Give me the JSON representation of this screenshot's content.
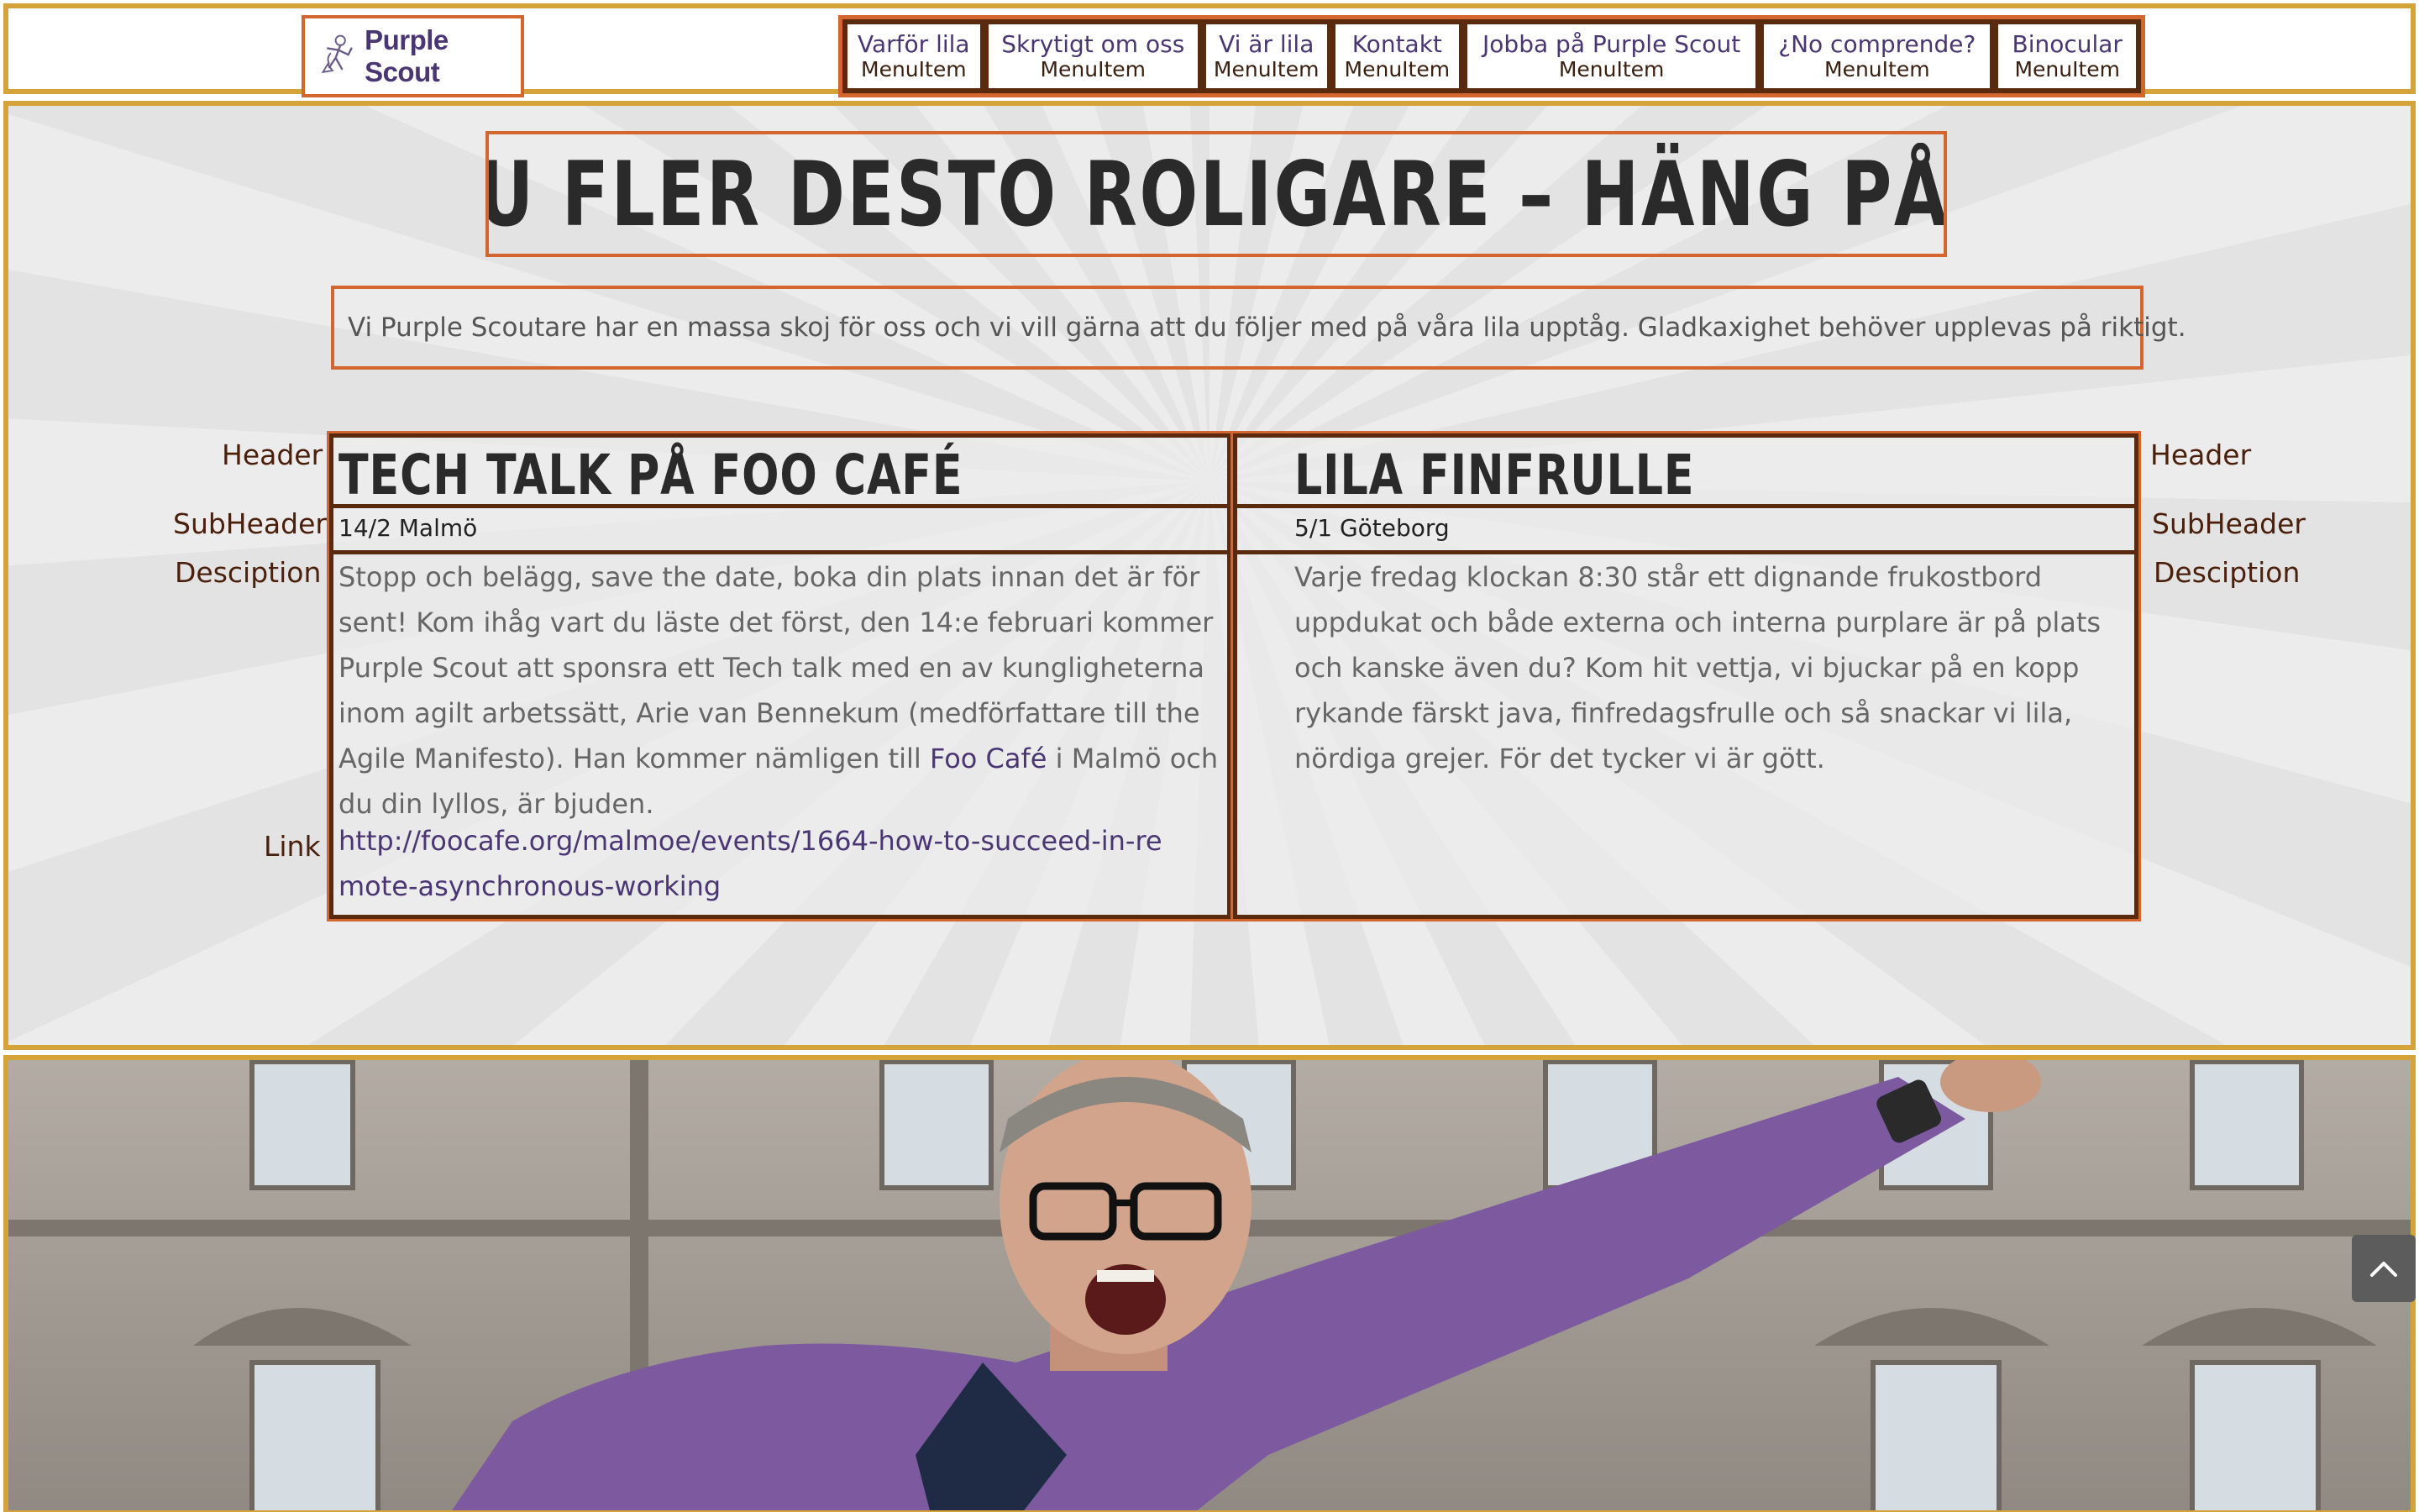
{
  "logo": {
    "text": "Purple Scout"
  },
  "menu": {
    "items": [
      {
        "label": "Varför lila",
        "sub": "MenuItem"
      },
      {
        "label": "Skrytigt om oss",
        "sub": "MenuItem"
      },
      {
        "label": "Vi är lila",
        "sub": "MenuItem"
      },
      {
        "label": "Kontakt",
        "sub": "MenuItem"
      },
      {
        "label": "Jobba på Purple Scout",
        "sub": "MenuItem"
      },
      {
        "label": "¿No comprende?",
        "sub": "MenuItem"
      },
      {
        "label": "Binocular",
        "sub": "MenuItem"
      }
    ]
  },
  "hero": {
    "headline": "JU FLER DESTO ROLIGARE –   HÄNG PÅ!",
    "intro": "Vi Purple Scoutare har en massa skoj för oss och vi vill gärna att du följer med på våra lila upptåg. Gladkaxighet behöver upplevas på riktigt."
  },
  "labels": {
    "header": "Header",
    "subheader": "SubHeader",
    "description": "Desciption",
    "link": "Link"
  },
  "events": [
    {
      "header": "TECH TALK PÅ FOO CAFÉ",
      "subheader": "14/2 Malmö",
      "desc_before": "Stopp och belägg, save the date, boka din plats innan det är för sent! Kom ihåg vart du läste det först, den 14:e februari kommer Purple Scout att sponsra ett Tech talk med en av kungligheterna inom agilt arbetssätt, Arie van Bennekum (medförfattare till the Agile Manifesto). Han kommer nämligen till ",
      "desc_link": "Foo Café",
      "desc_after": " i Malmö och du din lyllos, är bjuden.",
      "link": "http://foocafe.org/malmoe/events/1664-how-to-succeed-in-remote-asynchronous-working"
    },
    {
      "header": "LILA FINFRULLE",
      "subheader": "5/1 Göteborg",
      "desc": "Varje fredag klockan 8:30 står ett dignande frukostbord uppdukat och både externa och interna purplare är på plats och kanske även du? Kom hit vettja, vi bjuckar på en kopp rykande färskt java, finfredagsfrulle och så snackar vi lila, nördiga grejer. För det tycker vi är gött."
    }
  ],
  "colors": {
    "brand_purple": "#4a3672",
    "frame_gold": "#d4a33a",
    "frame_orange": "#d3662f",
    "frame_brown": "#5a2a0f"
  },
  "icons": {
    "scroll_top": "chevron-up-icon",
    "logo": "scout-figure-icon"
  }
}
